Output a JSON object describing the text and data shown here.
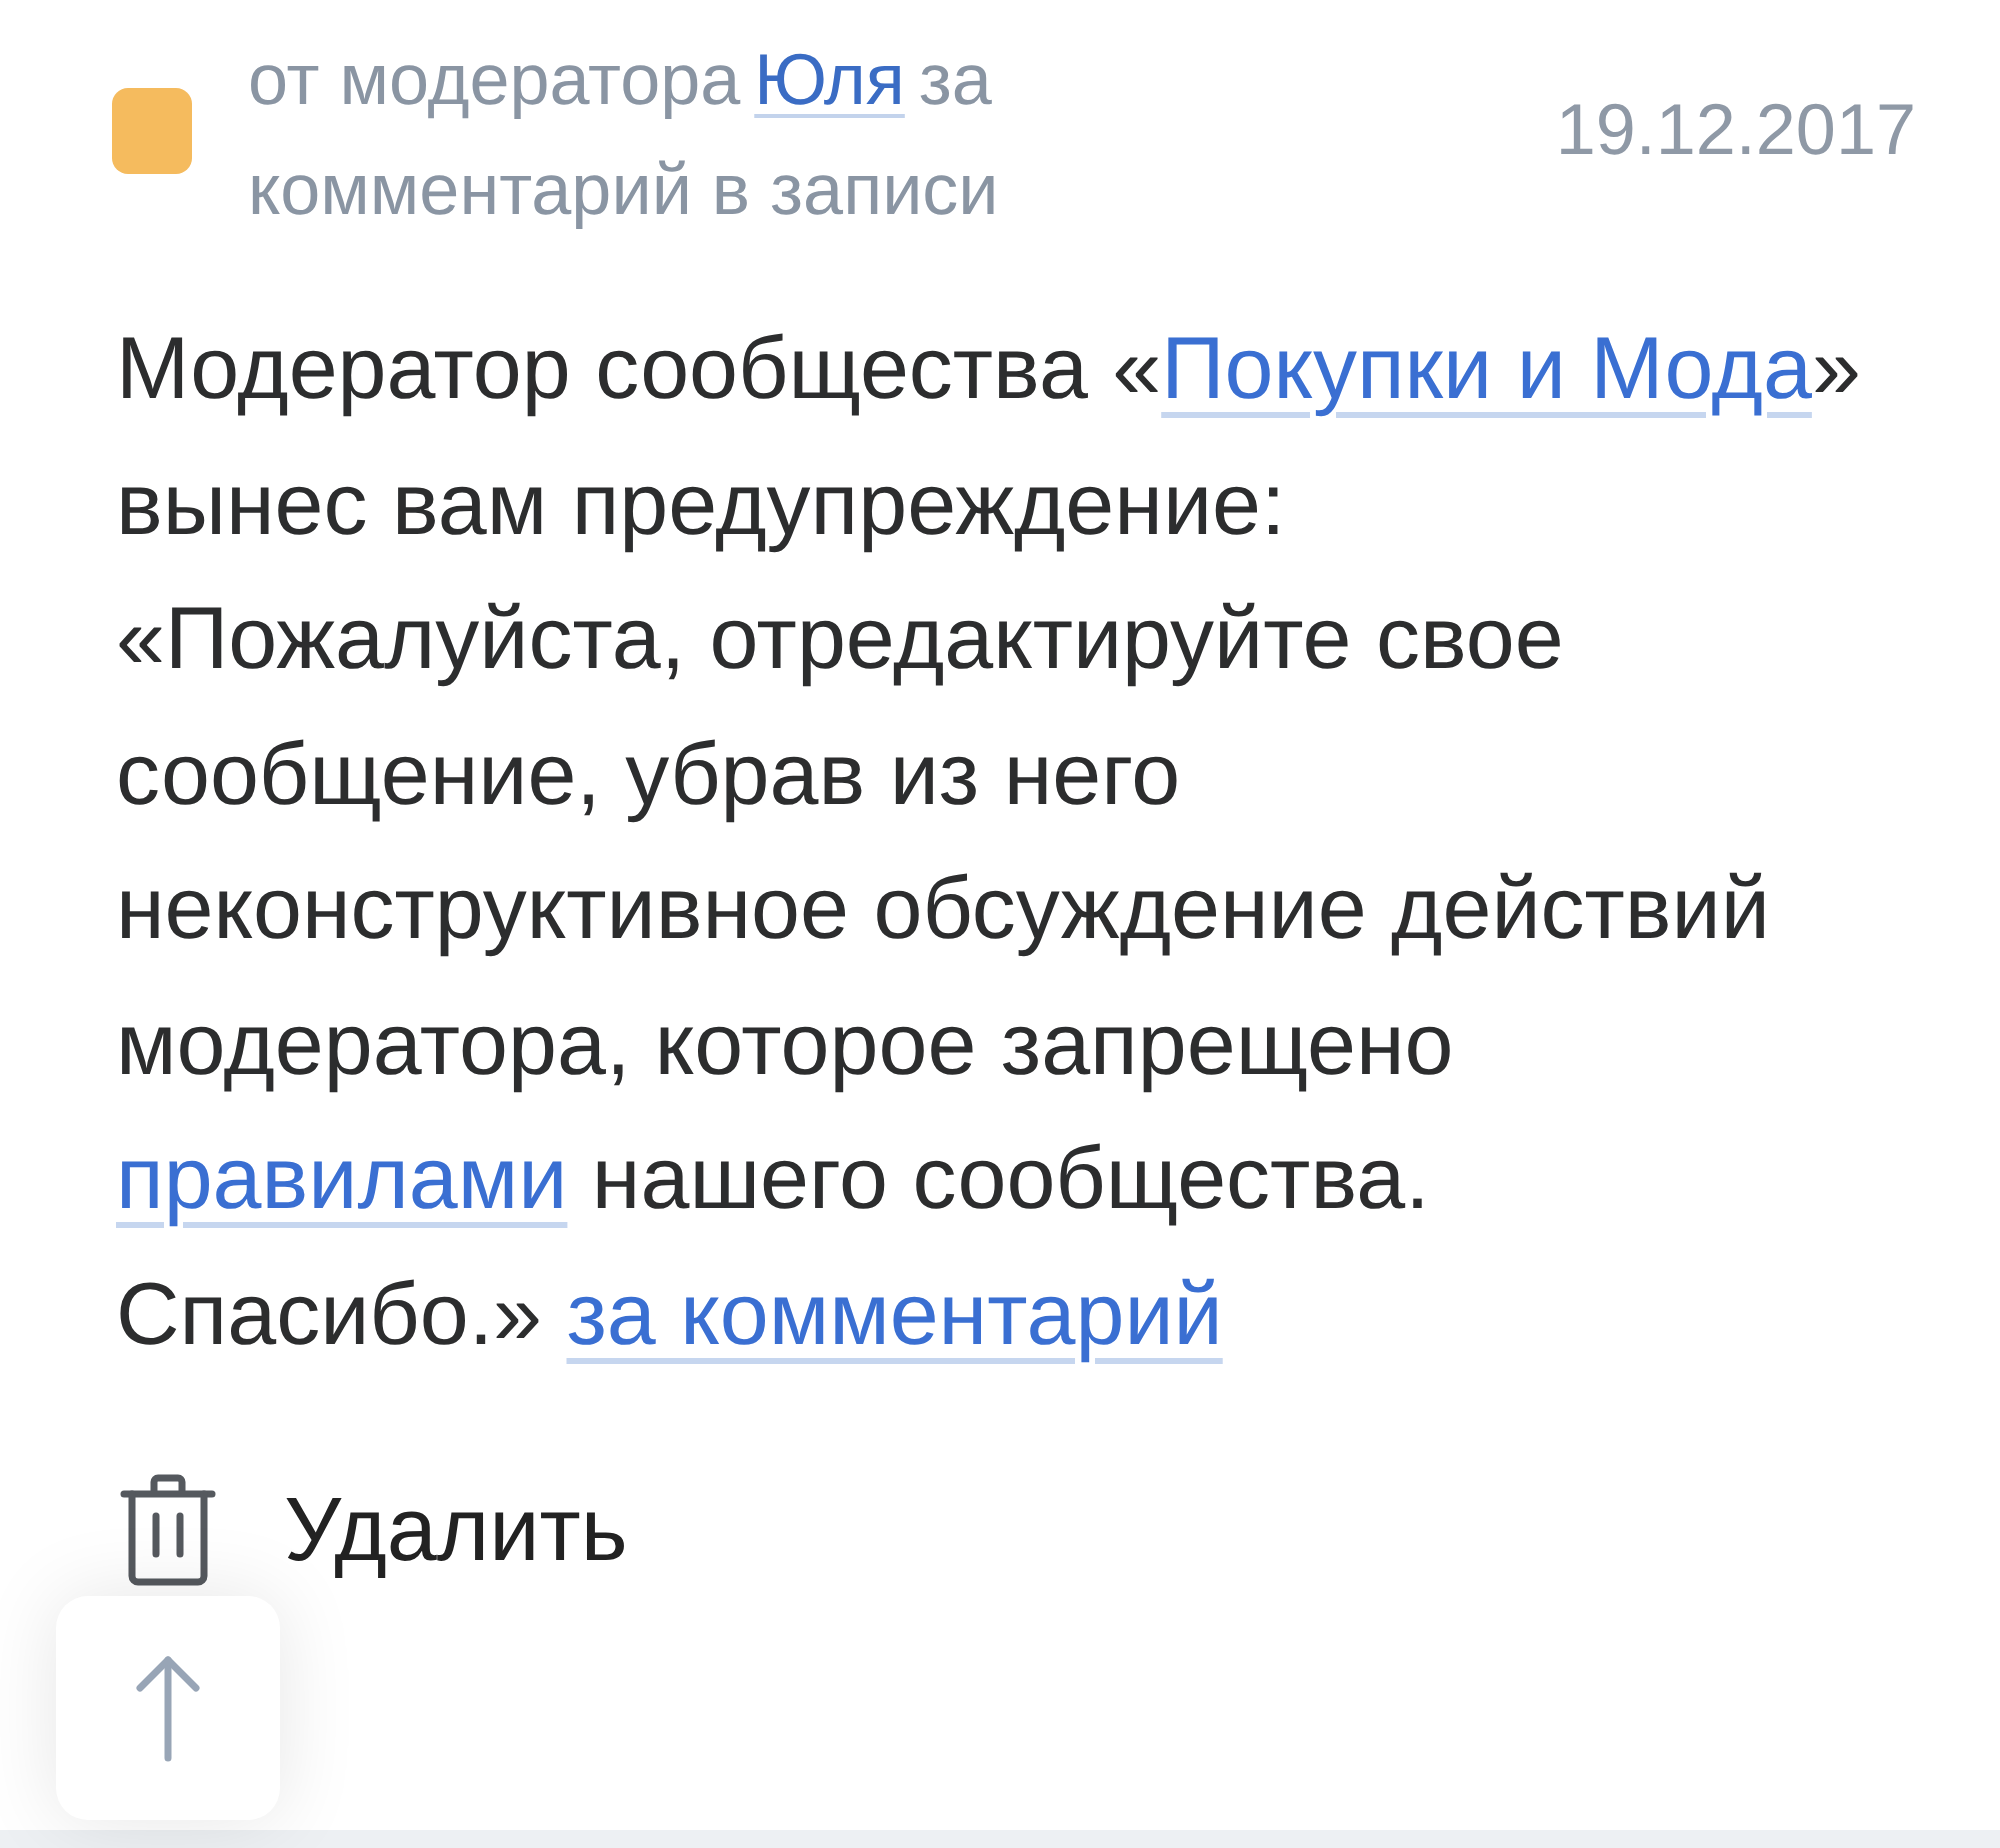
{
  "notification": {
    "header": [
      {
        "kind": "text",
        "text": "от модератора"
      },
      {
        "kind": "link",
        "text": "Юля"
      },
      {
        "kind": "text",
        "text": "за комментарий в записи"
      }
    ],
    "date": "19.12.2017"
  },
  "message": [
    {
      "kind": "text",
      "text": "Модератор сообщества «"
    },
    {
      "kind": "link",
      "text": "Покупки и Мода"
    },
    {
      "kind": "text",
      "text": "» вынес вам предупреждение:\n«Пожалуйста, отредактируйте свое сообщение, убрав из него неконструктивное обсуждение действий модератора, которое запрещено "
    },
    {
      "kind": "link",
      "text": "правилами"
    },
    {
      "kind": "text",
      "text": " нашего сообщества.\nСпасибо.» "
    },
    {
      "kind": "link",
      "text": "за комментарий"
    }
  ],
  "actions": [
    {
      "label": "Удалить"
    }
  ]
}
